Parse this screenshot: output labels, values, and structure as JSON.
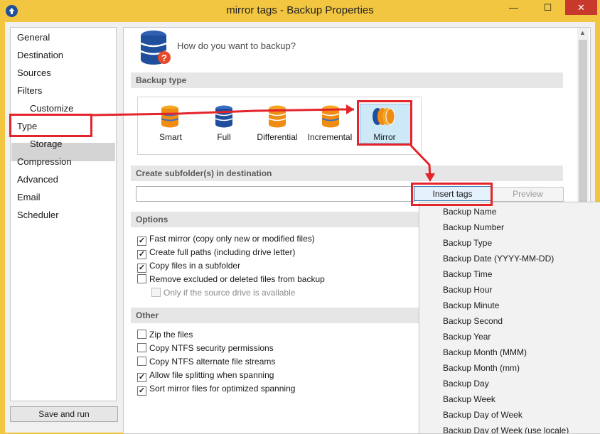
{
  "window": {
    "title": "mirror tags - Backup Properties",
    "minimize": "—",
    "maximize": "☐",
    "close": "✕"
  },
  "sidebar": {
    "items": [
      "General",
      "Destination",
      "Sources",
      "Filters",
      "Customize",
      "Type",
      "Storage",
      "Compression",
      "Advanced",
      "Email",
      "Scheduler"
    ],
    "selected": "Type"
  },
  "footer": {
    "save_and_run": "Save and run"
  },
  "main": {
    "question": "How do you want to backup?",
    "backup_type_header": "Backup type",
    "types": [
      "Smart",
      "Full",
      "Differential",
      "Incremental",
      "Mirror"
    ],
    "selected_type": "Mirror",
    "subfolder_header": "Create subfolder(s) in destination",
    "subfolder_value": "",
    "insert_tags": "Insert tags",
    "preview": "Preview",
    "options_header": "Options",
    "options": [
      {
        "label": "Fast mirror (copy only new or modified files)",
        "checked": true
      },
      {
        "label": "Create full paths (including drive letter)",
        "checked": true
      },
      {
        "label": "Copy files in a subfolder",
        "checked": true
      },
      {
        "label": "Remove excluded or deleted files from backup",
        "checked": false
      },
      {
        "label": "Only if the source drive is available",
        "checked": false,
        "disabled": true
      }
    ],
    "other_header": "Other",
    "other": [
      {
        "label": "Zip the files",
        "checked": false
      },
      {
        "label": "Copy NTFS security permissions",
        "checked": false
      },
      {
        "label": "Copy NTFS alternate file streams",
        "checked": false
      },
      {
        "label": "Allow file splitting when spanning",
        "checked": true
      },
      {
        "label": "Sort mirror files for optimized spanning",
        "checked": true
      }
    ]
  },
  "tags_menu": {
    "items": [
      "Backup Name",
      "Backup Number",
      "Backup Type",
      "Backup Date (YYYY-MM-DD)",
      "Backup Time",
      "Backup Hour",
      "Backup Minute",
      "Backup Second",
      "Backup Year",
      "Backup Month (MMM)",
      "Backup Month (mm)",
      "Backup Day",
      "Backup Week",
      "Backup Day of Week",
      "Backup Day of Week (use locale)"
    ]
  },
  "colors": {
    "titlebar": "#f2c640",
    "annotation": "#e3242b",
    "selection": "#cde8f7"
  }
}
